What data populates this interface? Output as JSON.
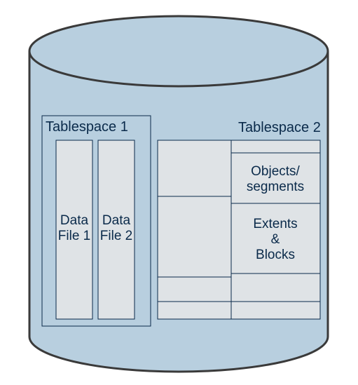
{
  "colors": {
    "cylinder_fill": "#b8cfdf",
    "cylinder_stroke": "#3a3a3a",
    "box_fill": "#dfe3e6",
    "box_stroke": "#0a2a4a",
    "text": "#0a2a4a"
  },
  "tablespace1": {
    "title": "Tablespace 1",
    "datafile1_line1": "Data",
    "datafile1_line2": "File 1",
    "datafile2_line1": "Data",
    "datafile2_line2": "File 2"
  },
  "tablespace2": {
    "title": "Tablespace 2",
    "objects_line1": "Objects/",
    "objects_line2": "segments",
    "extents_line1": "Extents",
    "extents_line2": "&",
    "extents_line3": "Blocks"
  }
}
